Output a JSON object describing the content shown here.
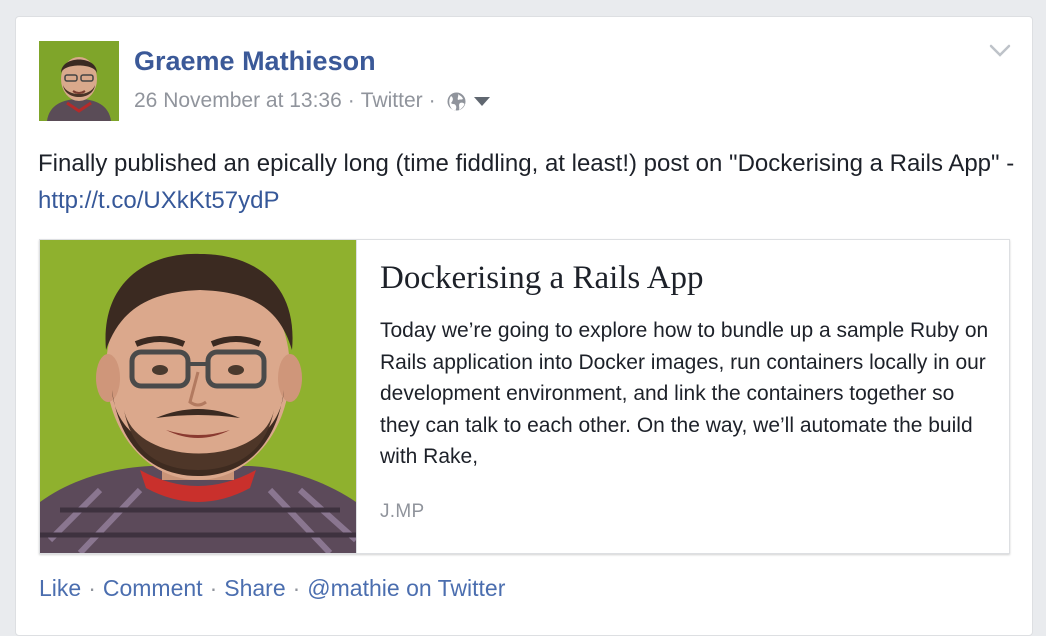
{
  "post": {
    "author": "Graeme Mathieson",
    "date": "26 November at 13:36",
    "source": "Twitter",
    "separator": "·",
    "audience_icon": "globe-icon",
    "menu_icon": "chevron-down-icon",
    "status_text": "Finally published an epically long (time fiddling, at least!) post on \"Dockerising a Rails App\" - ",
    "status_link": "http://t.co/UXkKt57ydP"
  },
  "link_card": {
    "title": "Dockerising a Rails App",
    "description": "Today we’re going to explore how to bundle up a sample Ruby on Rails application into Docker images, run containers locally in our development environment, and link the containers together so they can talk to each other. On the way, we’ll automate the build with Rake,",
    "domain": "J.MP"
  },
  "actions": {
    "like": "Like",
    "comment": "Comment",
    "share": "Share",
    "via": "@mathie on Twitter",
    "separator": "·"
  },
  "colors": {
    "link": "#365899",
    "author": "#3b5998",
    "meta": "#90949c",
    "text": "#1d2129",
    "photo_background": "#8fb12e"
  }
}
